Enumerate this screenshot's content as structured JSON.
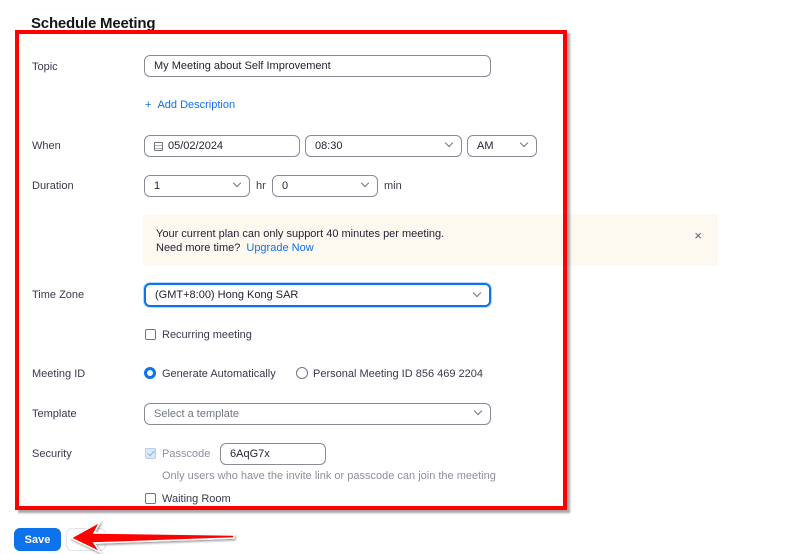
{
  "page": {
    "title": "Schedule Meeting"
  },
  "topic": {
    "label": "Topic",
    "value": "My Meeting about Self Improvement"
  },
  "description": {
    "add_label": "Add Description",
    "icon": "plus-icon"
  },
  "when": {
    "label": "When",
    "date": "05/02/2024",
    "time": "08:30",
    "ampm": "AM",
    "date_icon": "calendar-icon"
  },
  "duration": {
    "label": "Duration",
    "hours": "1",
    "hours_unit": "hr",
    "minutes": "0",
    "minutes_unit": "min"
  },
  "notice": {
    "line1": "Your current plan can only support 40 minutes per meeting.",
    "line2": "Need more time?",
    "upgrade_link": "Upgrade Now",
    "close_icon": "×"
  },
  "timezone": {
    "label": "Time Zone",
    "value": "(GMT+8:00) Hong Kong SAR"
  },
  "recurring": {
    "label": "Recurring meeting",
    "checked": false
  },
  "meeting_id": {
    "label": "Meeting ID",
    "options": [
      {
        "label": "Generate Automatically",
        "selected": true
      },
      {
        "label": "Personal Meeting ID 856 469 2204",
        "selected": false
      }
    ]
  },
  "template": {
    "label": "Template",
    "placeholder": "Select a template"
  },
  "security": {
    "label": "Security",
    "passcode_label": "Passcode",
    "passcode_value": "6AqG7x",
    "passcode_hint": "Only users who have the invite link or passcode can join the meeting",
    "waiting_room_label": "Waiting Room"
  },
  "actions": {
    "save_label": "Save"
  },
  "annotation": {
    "box_color": "#ff0000",
    "arrow_color": "#ff0000"
  },
  "colors": {
    "accent": "#0e72ed",
    "notice_bg": "#fdf8f0"
  }
}
